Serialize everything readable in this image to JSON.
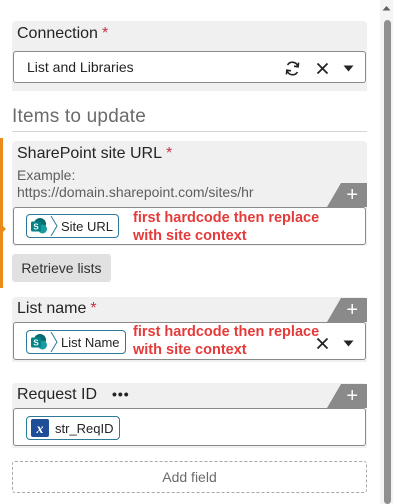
{
  "connection": {
    "label": "Connection",
    "required_mark": "*",
    "value": "List and Libraries",
    "icons": [
      "refresh-icon",
      "close-icon",
      "chevron-down-icon"
    ]
  },
  "items_section": {
    "title": "Items to update"
  },
  "site_url": {
    "label": "SharePoint site URL",
    "required_mark": "*",
    "example_line1": "Example:",
    "example_line2": "https://domain.sharepoint.com/sites/hr",
    "chip_label": "Site URL",
    "annotation_line1": "first hardcode then replace",
    "annotation_line2": "with site context",
    "add_symbol": "+"
  },
  "retrieve_button": {
    "label": "Retrieve lists"
  },
  "list_name": {
    "label": "List name",
    "required_mark": "*",
    "chip_label": "List Name",
    "annotation_line1": "first hardcode then replace",
    "annotation_line2": "with site context",
    "add_symbol": "+"
  },
  "request_id": {
    "label": "Request ID",
    "more_symbol": "•••",
    "chip_label": "str_ReqID",
    "add_symbol": "+"
  },
  "add_field": {
    "label": "Add field"
  },
  "colors": {
    "accent_orange": "#e98a1b",
    "annotation_red": "#e53a3a",
    "required_red": "#c4314b",
    "chip_border": "#2b7a9a",
    "sharepoint_teal": "#038387",
    "variable_blue": "#1f4e99"
  }
}
